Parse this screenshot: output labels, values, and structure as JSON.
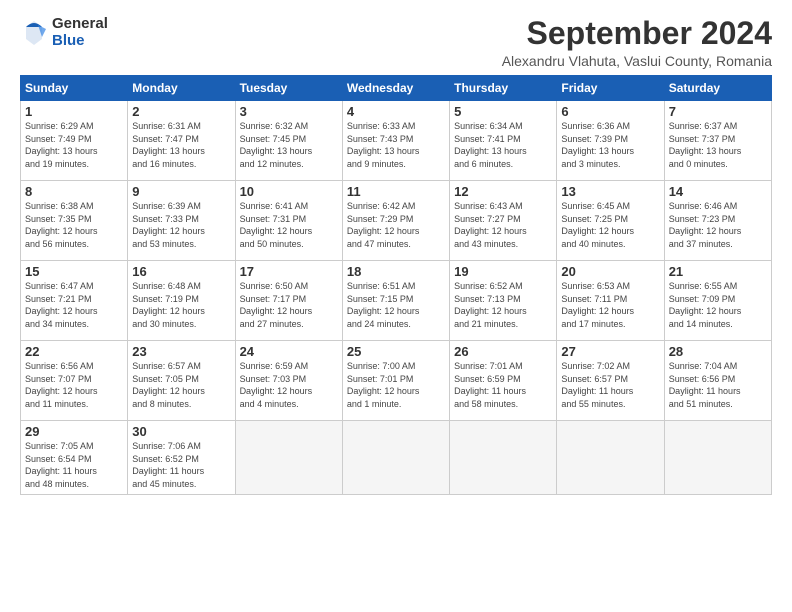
{
  "header": {
    "logo_general": "General",
    "logo_blue": "Blue",
    "month_title": "September 2024",
    "location": "Alexandru Vlahuta, Vaslui County, Romania"
  },
  "weekdays": [
    "Sunday",
    "Monday",
    "Tuesday",
    "Wednesday",
    "Thursday",
    "Friday",
    "Saturday"
  ],
  "weeks": [
    [
      {
        "day": "1",
        "info": "Sunrise: 6:29 AM\nSunset: 7:49 PM\nDaylight: 13 hours\nand 19 minutes."
      },
      {
        "day": "2",
        "info": "Sunrise: 6:31 AM\nSunset: 7:47 PM\nDaylight: 13 hours\nand 16 minutes."
      },
      {
        "day": "3",
        "info": "Sunrise: 6:32 AM\nSunset: 7:45 PM\nDaylight: 13 hours\nand 12 minutes."
      },
      {
        "day": "4",
        "info": "Sunrise: 6:33 AM\nSunset: 7:43 PM\nDaylight: 13 hours\nand 9 minutes."
      },
      {
        "day": "5",
        "info": "Sunrise: 6:34 AM\nSunset: 7:41 PM\nDaylight: 13 hours\nand 6 minutes."
      },
      {
        "day": "6",
        "info": "Sunrise: 6:36 AM\nSunset: 7:39 PM\nDaylight: 13 hours\nand 3 minutes."
      },
      {
        "day": "7",
        "info": "Sunrise: 6:37 AM\nSunset: 7:37 PM\nDaylight: 13 hours\nand 0 minutes."
      }
    ],
    [
      {
        "day": "8",
        "info": "Sunrise: 6:38 AM\nSunset: 7:35 PM\nDaylight: 12 hours\nand 56 minutes."
      },
      {
        "day": "9",
        "info": "Sunrise: 6:39 AM\nSunset: 7:33 PM\nDaylight: 12 hours\nand 53 minutes."
      },
      {
        "day": "10",
        "info": "Sunrise: 6:41 AM\nSunset: 7:31 PM\nDaylight: 12 hours\nand 50 minutes."
      },
      {
        "day": "11",
        "info": "Sunrise: 6:42 AM\nSunset: 7:29 PM\nDaylight: 12 hours\nand 47 minutes."
      },
      {
        "day": "12",
        "info": "Sunrise: 6:43 AM\nSunset: 7:27 PM\nDaylight: 12 hours\nand 43 minutes."
      },
      {
        "day": "13",
        "info": "Sunrise: 6:45 AM\nSunset: 7:25 PM\nDaylight: 12 hours\nand 40 minutes."
      },
      {
        "day": "14",
        "info": "Sunrise: 6:46 AM\nSunset: 7:23 PM\nDaylight: 12 hours\nand 37 minutes."
      }
    ],
    [
      {
        "day": "15",
        "info": "Sunrise: 6:47 AM\nSunset: 7:21 PM\nDaylight: 12 hours\nand 34 minutes."
      },
      {
        "day": "16",
        "info": "Sunrise: 6:48 AM\nSunset: 7:19 PM\nDaylight: 12 hours\nand 30 minutes."
      },
      {
        "day": "17",
        "info": "Sunrise: 6:50 AM\nSunset: 7:17 PM\nDaylight: 12 hours\nand 27 minutes."
      },
      {
        "day": "18",
        "info": "Sunrise: 6:51 AM\nSunset: 7:15 PM\nDaylight: 12 hours\nand 24 minutes."
      },
      {
        "day": "19",
        "info": "Sunrise: 6:52 AM\nSunset: 7:13 PM\nDaylight: 12 hours\nand 21 minutes."
      },
      {
        "day": "20",
        "info": "Sunrise: 6:53 AM\nSunset: 7:11 PM\nDaylight: 12 hours\nand 17 minutes."
      },
      {
        "day": "21",
        "info": "Sunrise: 6:55 AM\nSunset: 7:09 PM\nDaylight: 12 hours\nand 14 minutes."
      }
    ],
    [
      {
        "day": "22",
        "info": "Sunrise: 6:56 AM\nSunset: 7:07 PM\nDaylight: 12 hours\nand 11 minutes."
      },
      {
        "day": "23",
        "info": "Sunrise: 6:57 AM\nSunset: 7:05 PM\nDaylight: 12 hours\nand 8 minutes."
      },
      {
        "day": "24",
        "info": "Sunrise: 6:59 AM\nSunset: 7:03 PM\nDaylight: 12 hours\nand 4 minutes."
      },
      {
        "day": "25",
        "info": "Sunrise: 7:00 AM\nSunset: 7:01 PM\nDaylight: 12 hours\nand 1 minute."
      },
      {
        "day": "26",
        "info": "Sunrise: 7:01 AM\nSunset: 6:59 PM\nDaylight: 11 hours\nand 58 minutes."
      },
      {
        "day": "27",
        "info": "Sunrise: 7:02 AM\nSunset: 6:57 PM\nDaylight: 11 hours\nand 55 minutes."
      },
      {
        "day": "28",
        "info": "Sunrise: 7:04 AM\nSunset: 6:56 PM\nDaylight: 11 hours\nand 51 minutes."
      }
    ],
    [
      {
        "day": "29",
        "info": "Sunrise: 7:05 AM\nSunset: 6:54 PM\nDaylight: 11 hours\nand 48 minutes."
      },
      {
        "day": "30",
        "info": "Sunrise: 7:06 AM\nSunset: 6:52 PM\nDaylight: 11 hours\nand 45 minutes."
      },
      {
        "day": "",
        "info": ""
      },
      {
        "day": "",
        "info": ""
      },
      {
        "day": "",
        "info": ""
      },
      {
        "day": "",
        "info": ""
      },
      {
        "day": "",
        "info": ""
      }
    ]
  ]
}
